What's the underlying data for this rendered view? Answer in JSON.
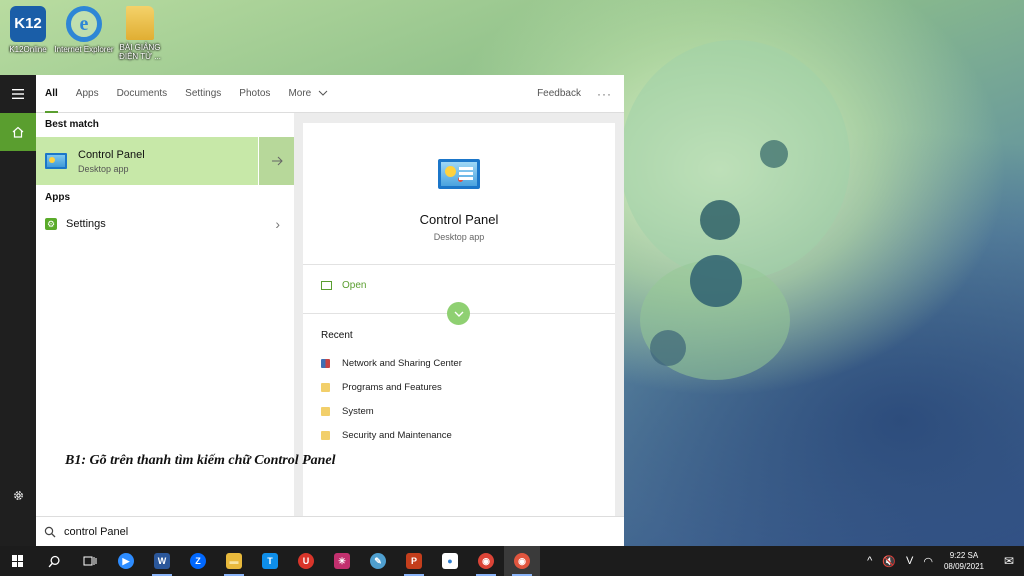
{
  "desktop": {
    "icons": [
      {
        "name": "K12Online",
        "glyph": "K12"
      },
      {
        "name": "Internet Explorer",
        "glyph": "e"
      },
      {
        "name": "BÀI GIẢNG ĐIỆN TỬ ...",
        "glyph": ""
      }
    ]
  },
  "search": {
    "tabs": [
      "All",
      "Apps",
      "Documents",
      "Settings",
      "Photos",
      "More"
    ],
    "feedback": "Feedback",
    "more_options": "···",
    "best_match_heading": "Best match",
    "best_match": {
      "title": "Control Panel",
      "subtitle": "Desktop app"
    },
    "apps_heading": "Apps",
    "apps": [
      {
        "label": "Settings"
      }
    ],
    "detail": {
      "title": "Control Panel",
      "subtitle": "Desktop app",
      "open_label": "Open",
      "recent_heading": "Recent",
      "recent": [
        {
          "label": "Network and Sharing Center",
          "icon": "network-icon"
        },
        {
          "label": "Programs and Features",
          "icon": "folder-icon"
        },
        {
          "label": "System",
          "icon": "folder-icon"
        },
        {
          "label": "Security and Maintenance",
          "icon": "folder-icon"
        }
      ]
    },
    "query": "control Panel"
  },
  "caption": "B1: Gõ trên thanh tìm kiếm chữ Control Panel",
  "taskbar": {
    "apps": [
      {
        "name": "search-icon",
        "glyph": "⌕",
        "color": ""
      },
      {
        "name": "task-view-icon",
        "glyph": "☷",
        "color": ""
      },
      {
        "name": "zoom-icon",
        "glyph": "▶",
        "color": "#2d8cff"
      },
      {
        "name": "word-icon",
        "glyph": "W",
        "color": "#2b579a"
      },
      {
        "name": "zalo-icon",
        "glyph": "Z",
        "color": "#0068ff"
      },
      {
        "name": "file-explorer-icon",
        "glyph": "▬",
        "color": "#e8b93c"
      },
      {
        "name": "teamviewer-icon",
        "glyph": "T",
        "color": "#0e8ee9"
      },
      {
        "name": "ultraviewer-icon",
        "glyph": "U",
        "color": "#d9352a"
      },
      {
        "name": "app-pink-icon",
        "glyph": "✳",
        "color": "#c2306e"
      },
      {
        "name": "paint-icon",
        "glyph": "✎",
        "color": "#4f9fcf"
      },
      {
        "name": "powerpoint-icon",
        "glyph": "P",
        "color": "#c43e1c"
      },
      {
        "name": "photos-icon",
        "glyph": "●",
        "color": "#2f7fd1"
      },
      {
        "name": "chrome-icon",
        "glyph": "◉",
        "color": "#db4437"
      },
      {
        "name": "chrome-user-icon",
        "glyph": "◉",
        "color": "#e0553e"
      }
    ],
    "tray": {
      "chevron": "^",
      "volume": "🔇",
      "ime": "V",
      "wifi": "◠",
      "time": "9:22 SA",
      "date": "08/09/2021",
      "notifications": "✉"
    }
  }
}
